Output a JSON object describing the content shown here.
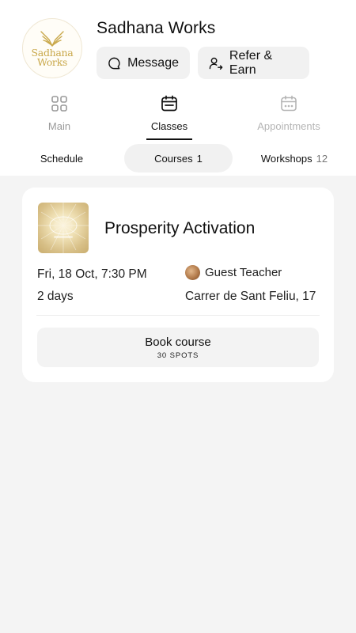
{
  "studio": {
    "name": "Sadhana Works",
    "logo_text_line1": "Sadhana",
    "logo_text_line2": "Works",
    "brand_color": "#c9a84a"
  },
  "actions": {
    "message_label": "Message",
    "refer_label": "Refer & Earn"
  },
  "main_tabs": [
    {
      "label": "Main",
      "icon": "grid-icon",
      "state": "inactive"
    },
    {
      "label": "Classes",
      "icon": "calendar-icon",
      "state": "active"
    },
    {
      "label": "Appointments",
      "icon": "calendar-dots-icon",
      "state": "disabled"
    }
  ],
  "sub_tabs": [
    {
      "label": "Schedule",
      "count": ""
    },
    {
      "label": "Courses",
      "count": "1",
      "selected": true
    },
    {
      "label": "Workshops",
      "count": "12"
    }
  ],
  "course": {
    "title": "Prosperity Activation",
    "date": "Fri, 18 Oct, 7:30 PM",
    "duration": "2 days",
    "teacher": "Guest Teacher",
    "location": "Carrer de Sant Feliu, 17",
    "book_label": "Book course",
    "spots": "30 SPOTS"
  }
}
